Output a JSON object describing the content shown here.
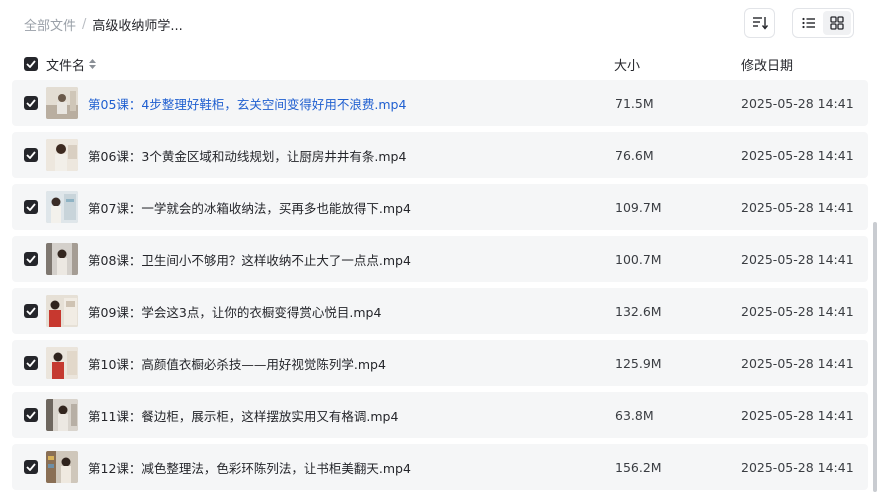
{
  "breadcrumb": {
    "root": "全部文件",
    "separator": "/",
    "current": "高级收纳师学..."
  },
  "table": {
    "headers": {
      "name": "文件名",
      "size": "大小",
      "date": "修改日期"
    },
    "rows": [
      {
        "name": "第05课：4步整理好鞋柜，玄关空间变得好用不浪费.mp4",
        "size": "71.5M",
        "date": "2025-05-28 14:41",
        "highlight": true
      },
      {
        "name": "第06课：3个黄金区域和动线规划，让厨房井井有条.mp4",
        "size": "76.6M",
        "date": "2025-05-28 14:41"
      },
      {
        "name": "第07课：一学就会的冰箱收纳法，买再多也能放得下.mp4",
        "size": "109.7M",
        "date": "2025-05-28 14:41"
      },
      {
        "name": "第08课：卫生间小不够用？这样收纳不止大了一点点.mp4",
        "size": "100.7M",
        "date": "2025-05-28 14:41"
      },
      {
        "name": "第09课：学会这3点，让你的衣橱变得赏心悦目.mp4",
        "size": "132.6M",
        "date": "2025-05-28 14:41"
      },
      {
        "name": "第10课：高颜值衣橱必杀技——用好视觉陈列学.mp4",
        "size": "125.9M",
        "date": "2025-05-28 14:41"
      },
      {
        "name": "第11课：餐边柜，展示柜，这样摆放实用又有格调.mp4",
        "size": "63.8M",
        "date": "2025-05-28 14:41"
      },
      {
        "name": "第12课：减色整理法，色彩环陈列法，让书柜美翻天.mp4",
        "size": "156.2M",
        "date": "2025-05-28 14:41"
      }
    ]
  },
  "colors": {
    "accent_link": "#1f5fd0",
    "checkbox": "#25262b",
    "row_bg": "#f5f6f7"
  },
  "icons": {
    "sort": "sort-lines-icon",
    "list_view": "list-view-icon",
    "grid_view": "grid-view-icon",
    "check": "check-icon",
    "column_sort": "sort-arrows-icon"
  }
}
